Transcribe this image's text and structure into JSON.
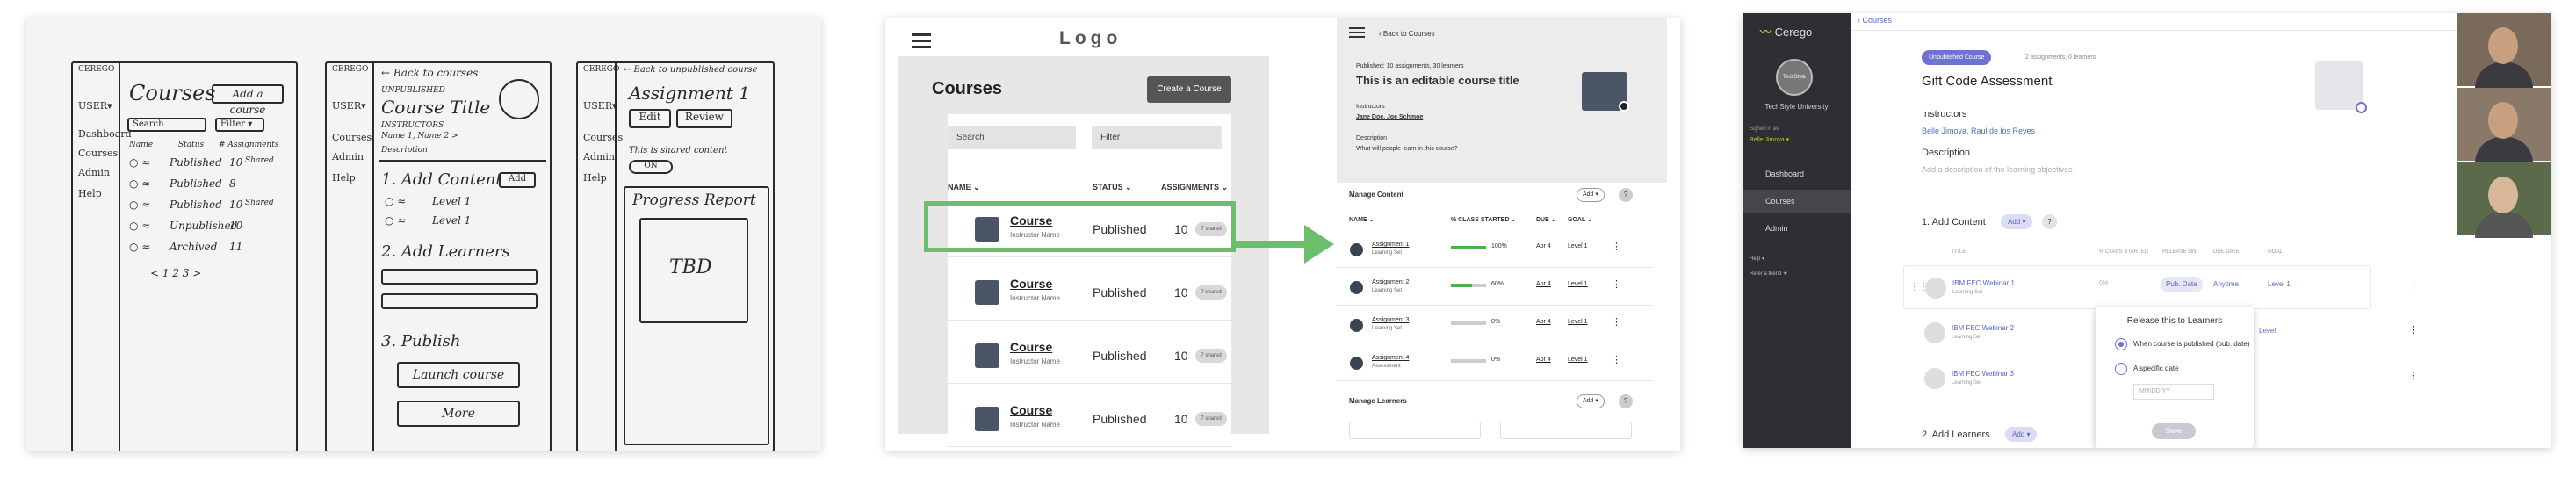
{
  "sketch": {
    "s1": {
      "logo": "CEREGO",
      "side": [
        "USER▾",
        "Dashboard",
        "Courses",
        "Admin",
        "Help"
      ],
      "title": "Courses",
      "add_button": "Add a course",
      "search": "Search",
      "filter": "Filter ▾",
      "cols": [
        "Name",
        "Status",
        "# Assignments"
      ],
      "rows": [
        {
          "status": "Published",
          "count": "10",
          "tag": "Shared"
        },
        {
          "status": "Published",
          "count": "8",
          "tag": ""
        },
        {
          "status": "Published",
          "count": "10",
          "tag": "Shared"
        },
        {
          "status": "Unpublished",
          "count": "10",
          "tag": ""
        },
        {
          "status": "Archived",
          "count": "11",
          "tag": ""
        }
      ],
      "footer": "< 1 2 3 >"
    },
    "s2": {
      "logo": "CEREGO",
      "back": "← Back to courses",
      "side": [
        "USER▾",
        "Courses",
        "Admin",
        "Help"
      ],
      "status": "UNPUBLISHED",
      "title": "Course Title",
      "instructors": "INSTRUCTORS",
      "instructor_names": "Name 1, Name 2 >",
      "description": "Description",
      "s1": "1. Add Content",
      "add": "Add",
      "level1": "Level 1",
      "s2": "2. Add Learners",
      "s3": "3. Publish",
      "launch": "Launch course",
      "more": "More"
    },
    "s3": {
      "logo": "CEREGO",
      "back": "← Back to unpublished course",
      "side": [
        "USER▾",
        "Courses",
        "Admin",
        "Help"
      ],
      "title": "Assignment 1",
      "edit": "Edit",
      "review": "Review",
      "shared_note": "This is shared content",
      "toggle": "ON",
      "report": "Progress Report",
      "tbd": "TBD"
    }
  },
  "wire": {
    "logo": "Logo",
    "heading": "Courses",
    "create": "Create a Course",
    "search": "Search",
    "filter": "Filter",
    "cols": [
      "NAME ⌄",
      "STATUS ⌄",
      "ASSIGNMENTS ⌄"
    ],
    "rows": [
      {
        "name": "Course",
        "sub": "Instructor Name",
        "status": "Published",
        "num": "10",
        "pill": "7 shared"
      },
      {
        "name": "Course",
        "sub": "Instructor Name",
        "status": "Published",
        "num": "10",
        "pill": "7 shared"
      },
      {
        "name": "Course",
        "sub": "Instructor Name",
        "status": "Published",
        "num": "10",
        "pill": "7 shared"
      },
      {
        "name": "Course",
        "sub": "Instructor Name",
        "status": "Published",
        "num": "10",
        "pill": "7 shared"
      }
    ],
    "detail": {
      "back": "Back to Courses",
      "published": "Published: 10 assignments, 30 learners",
      "title": "This is an editable course title",
      "instructors_label": "Instructors",
      "instructors": "Jane Doe, Joe Schmoe",
      "desc_label": "Description",
      "desc": "What will people learn in this course?",
      "manage_content": "Manage Content",
      "add": "Add",
      "q": "?",
      "cols": [
        "NAME ⌄",
        "% CLASS STARTED ⌄",
        "DUE ⌄",
        "GOAL ⌄"
      ],
      "rows": [
        {
          "name": "Assignment 1",
          "sub": "Learning Set",
          "pct": "100%",
          "fill": 1.0,
          "due": "Apr 4",
          "goal": "Level 1"
        },
        {
          "name": "Assignment 2",
          "sub": "Learning Set",
          "pct": "60%",
          "fill": 0.6,
          "due": "Apr 4",
          "goal": "Level 1"
        },
        {
          "name": "Assignment 3",
          "sub": "Learning Set",
          "pct": "0%",
          "fill": 0.0,
          "due": "Apr 4",
          "goal": "Level 1"
        },
        {
          "name": "Assignment 4",
          "sub": "Assessment",
          "pct": "0%",
          "fill": 0.0,
          "due": "Apr 4",
          "goal": "Level 1"
        }
      ],
      "manage_learners": "Manage Learners"
    }
  },
  "app": {
    "brand": "Cerego",
    "avatar": "TechStyle",
    "uni": "TechStyle University",
    "signed_in": "Signed in as",
    "user": "Belle Jimoya ▾",
    "nav": [
      "Dashboard",
      "Courses",
      "Admin"
    ],
    "help": "Help ▾",
    "refer": "Refer a friend ★",
    "back": "Courses",
    "badge": "Unpublished Course",
    "meta": "2 assignments, 0 learners",
    "title": "Gift Code Assessment",
    "instructors_label": "Instructors",
    "instructors": "Belle Jimoya, Raul de los Reyes",
    "desc_label": "Description",
    "desc": "Add a description of the learning objectives",
    "sec1": "1. Add Content",
    "sec2": "2. Add Learners",
    "add": "Add ▾",
    "q": "?",
    "cols": [
      "TITLE",
      "% CLASS STARTED",
      "RELEASE ON",
      "DUE DATE",
      "GOAL"
    ],
    "rows": [
      {
        "name": "IBM FEC Webinar 1",
        "sub": "Learning Set"
      },
      {
        "name": "IBM FEC Webinar 2",
        "sub": "Learning Set"
      },
      {
        "name": "IBM FEC Webinar 3",
        "sub": "Learning Set"
      }
    ],
    "row1_pct": "0%",
    "row1_release": "Pub. Date",
    "row1_due": "Anytime",
    "row1_goal": "Level 1",
    "popup": {
      "title": "Release this to Learners",
      "opt1": "When course is published (pub. date)",
      "opt2": "A specific date",
      "date_placeholder": "MM/DD/YY",
      "save": "Save"
    },
    "partial_level": "Level"
  },
  "colors": {
    "accent_green": "#6cbf6a",
    "cerego_purple": "#6f72d3",
    "cerego_green": "#a8c832"
  }
}
